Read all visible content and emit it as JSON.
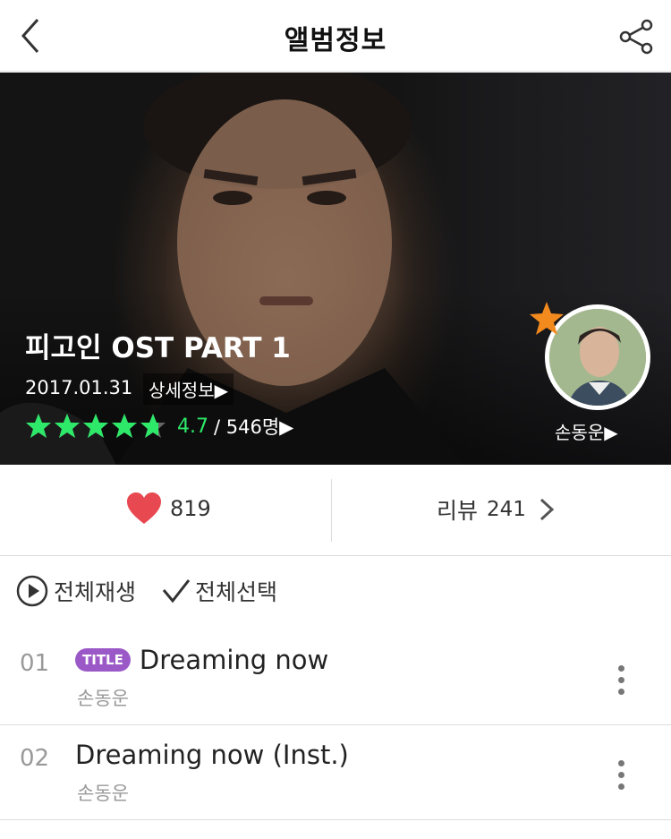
{
  "header": {
    "title": "앨범정보"
  },
  "album": {
    "title": "피고인 OST PART 1",
    "release_date": "2017.01.31",
    "detail_link": "상세정보▶",
    "rating": {
      "stars": 4.7,
      "score_text": "4.7",
      "count_text": "/ 546명▶"
    },
    "artist": {
      "name": "손동운▶"
    }
  },
  "actions": {
    "like_count": "819",
    "review_label": "리뷰",
    "review_count": "241"
  },
  "controls": {
    "play_all": "전체재생",
    "select_all": "전체선택"
  },
  "tracks": [
    {
      "number": "01",
      "badge": "TITLE",
      "title": "Dreaming now",
      "artist": "손동운"
    },
    {
      "number": "02",
      "badge": "",
      "title": "Dreaming now (Inst.)",
      "artist": "손동운"
    }
  ],
  "colors": {
    "rating_green": "#2ee86a",
    "heart_red": "#e8484f",
    "title_badge_purple": "#9b59c8",
    "artist_star_orange": "#f28a1e"
  },
  "icons": [
    "back-arrow-icon",
    "share-icon",
    "star-icon",
    "heart-icon",
    "chevron-right-icon",
    "play-circle-icon",
    "check-icon",
    "more-vertical-icon"
  ]
}
